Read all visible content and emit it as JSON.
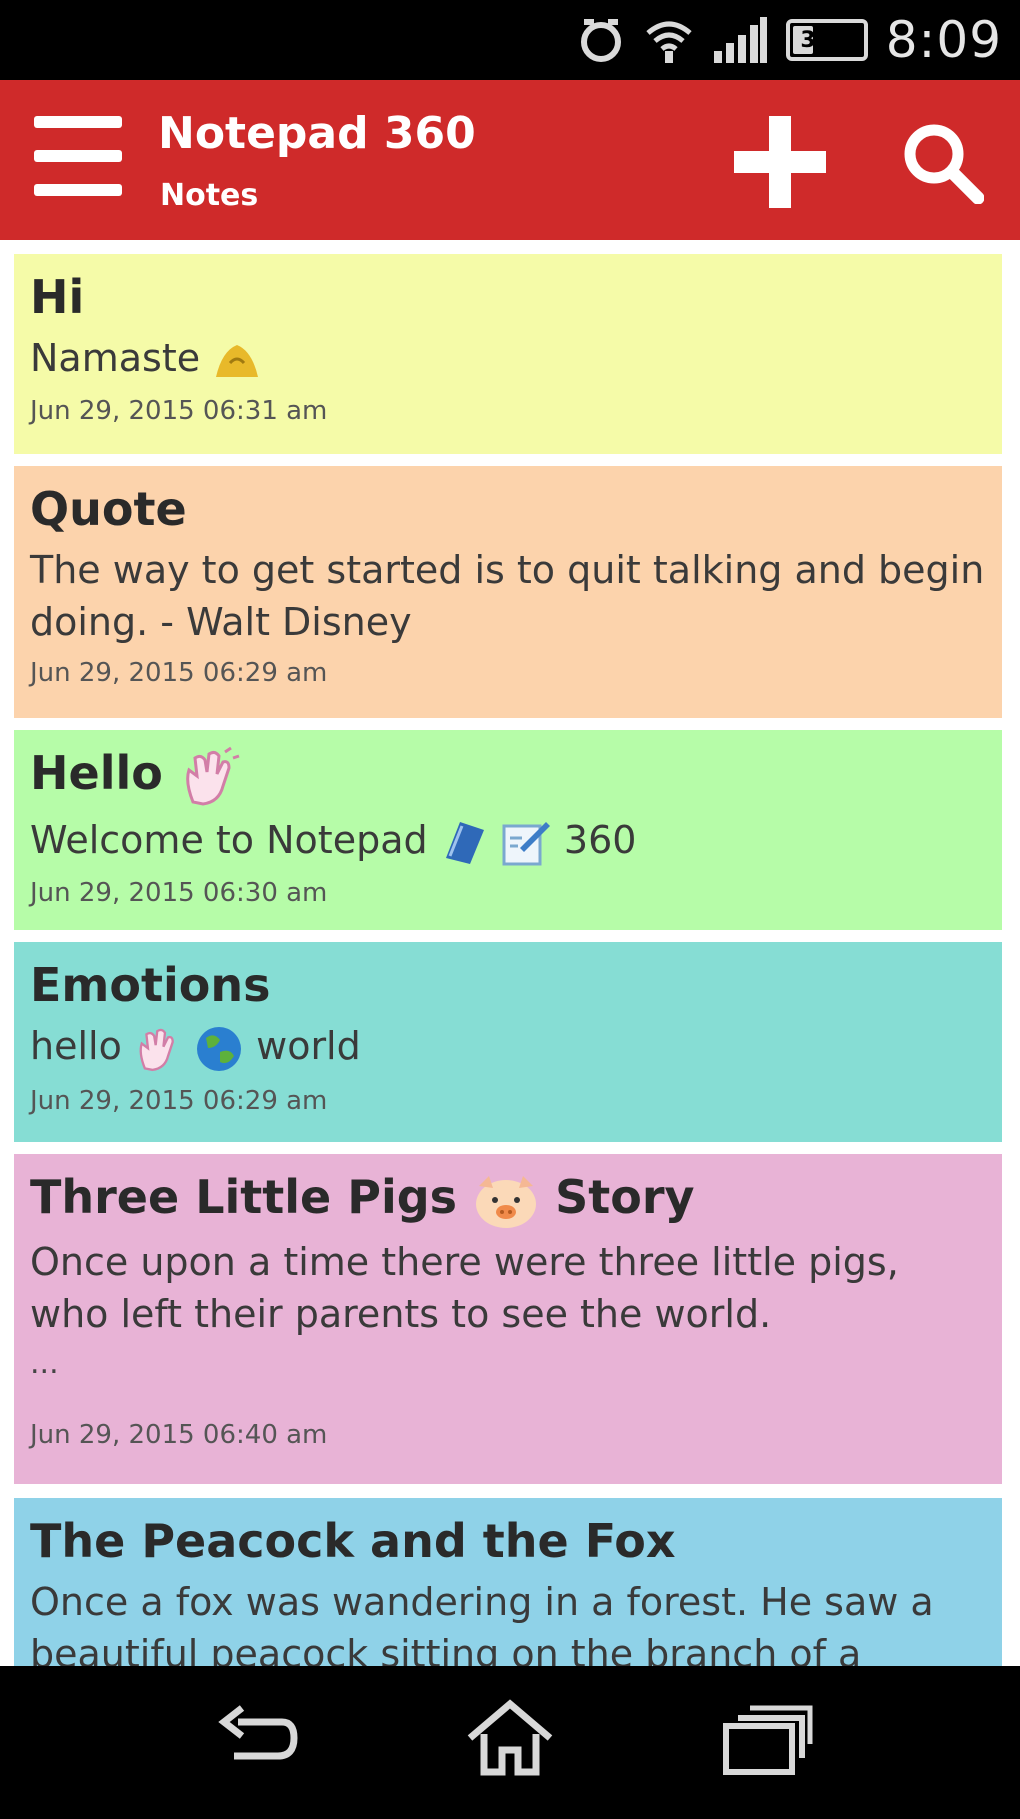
{
  "status_bar": {
    "battery": "31%",
    "time": "8:09"
  },
  "app_bar": {
    "title": "Notepad 360",
    "subtitle": "Notes",
    "icons": [
      "menu-icon",
      "add-icon",
      "search-icon"
    ]
  },
  "colors": {
    "app_bar": "#cf2a2a",
    "note_yellow": "#f5fba8",
    "note_peach": "#fcd3ac",
    "note_green": "#b6fca8",
    "note_teal": "#86ddd4",
    "note_pink": "#e8b3d6",
    "note_blue": "#8fd2e8"
  },
  "notes": [
    {
      "title": "Hi",
      "body": "Namaste",
      "body_icons": [
        "folded-hands-icon"
      ],
      "date": "Jun 29, 2015 06:31 am"
    },
    {
      "title": "Quote",
      "body": "The way to get started is to quit talking and begin doing. - Walt Disney",
      "date": "Jun 29, 2015 06:29 am"
    },
    {
      "title": "Hello",
      "title_icons": [
        "waving-hand-icon"
      ],
      "body_part1": "Welcome to Notepad",
      "body_icons": [
        "blue-book-icon",
        "memo-icon"
      ],
      "body_part2": "360",
      "date": "Jun 29, 2015 06:30 am"
    },
    {
      "title": "Emotions",
      "body_part1": "hello",
      "body_icons": [
        "waving-hand-icon",
        "globe-icon"
      ],
      "body_part2": "world",
      "date": "Jun 29, 2015 06:29 am"
    },
    {
      "title_part1": "Three Little Pigs",
      "title_icons": [
        "pig-face-icon"
      ],
      "title_part2": "Story",
      "body": "Once upon a time there were three little pigs, who left their parents to see the world.",
      "ellipsis": "...",
      "date": "Jun 29, 2015 06:40 am"
    },
    {
      "title": "The Peacock and the Fox",
      "body": "Once a fox was wandering in a forest. He saw a beautiful peacock sitting on the branch of a"
    }
  ],
  "nav_bar": {
    "icons": [
      "back-icon",
      "home-icon",
      "recents-icon"
    ]
  }
}
